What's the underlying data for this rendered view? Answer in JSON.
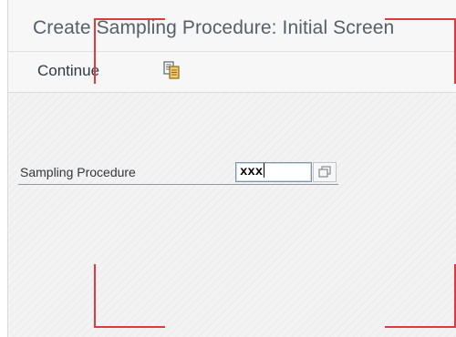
{
  "window": {
    "title": "Create Sampling Procedure: Initial Screen"
  },
  "toolbar": {
    "continue_label": "Continue",
    "copy_icon": "copy-from-template-icon"
  },
  "form": {
    "sampling_procedure": {
      "label": "Sampling Procedure",
      "value": "xxx",
      "value_help_icon": "value-help-icon"
    }
  },
  "colors": {
    "title_text": "#555f68",
    "field_border": "#89919a",
    "focus_marks": "#e0393e"
  }
}
